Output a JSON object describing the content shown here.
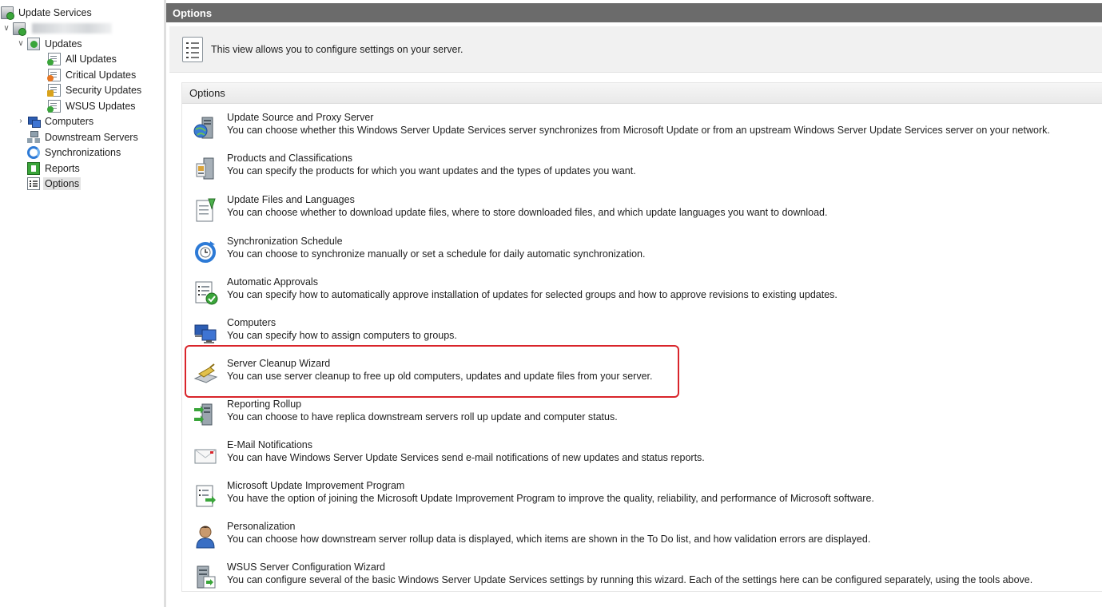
{
  "tree": {
    "root": "Update Services",
    "server": "",
    "updates": "Updates",
    "all_updates": "All Updates",
    "critical_updates": "Critical Updates",
    "security_updates": "Security Updates",
    "wsus_updates": "WSUS Updates",
    "computers": "Computers",
    "downstream_servers": "Downstream Servers",
    "synchronizations": "Synchronizations",
    "reports": "Reports",
    "options": "Options"
  },
  "main": {
    "title": "Options",
    "intro": "This view allows you to configure settings on your server.",
    "section_header": "Options",
    "items": [
      {
        "title": "Update Source and Proxy Server",
        "desc": "You can choose whether this Windows Server Update Services server synchronizes from Microsoft Update or from an upstream Windows Server Update Services server on your network.",
        "icon": "server-globe-icon"
      },
      {
        "title": "Products and Classifications",
        "desc": "You can specify the products for which you want updates and the types of updates you want.",
        "icon": "products-icon"
      },
      {
        "title": "Update Files and Languages",
        "desc": "You can choose whether to download update files, where to store downloaded files, and which update languages you want to download.",
        "icon": "update-files-icon"
      },
      {
        "title": "Synchronization Schedule",
        "desc": "You can choose to synchronize manually or set a schedule for daily automatic synchronization.",
        "icon": "sync-schedule-icon"
      },
      {
        "title": "Automatic Approvals",
        "desc": "You can specify how to automatically approve installation of updates for selected groups and how to approve revisions to existing updates.",
        "icon": "approvals-icon"
      },
      {
        "title": "Computers",
        "desc": "You can specify how to assign computers to groups.",
        "icon": "computers-icon"
      },
      {
        "title": "Server Cleanup Wizard",
        "desc": "You can use server cleanup to free up old computers, updates and update files from your server.",
        "icon": "cleanup-icon"
      },
      {
        "title": "Reporting Rollup",
        "desc": "You can choose to have replica downstream servers roll up update and computer status.",
        "icon": "rollup-icon"
      },
      {
        "title": "E-Mail Notifications",
        "desc": "You can have Windows Server Update Services send e-mail notifications of new updates and status reports.",
        "icon": "email-icon"
      },
      {
        "title": "Microsoft Update Improvement Program",
        "desc": "You have the option of joining the Microsoft Update Improvement Program to improve the quality, reliability, and performance of Microsoft software.",
        "icon": "improvement-program-icon"
      },
      {
        "title": "Personalization",
        "desc": "You can choose how downstream server rollup data is displayed, which items are shown in the To Do list, and how validation errors are displayed.",
        "icon": "personalization-icon"
      },
      {
        "title": "WSUS Server Configuration Wizard",
        "desc": "You can configure several of the basic Windows Server Update Services settings by running this wizard. Each of the settings here can be configured separately, using the tools above.",
        "icon": "config-wizard-icon"
      }
    ]
  },
  "colors": {
    "title_bar": "#6b6b6b",
    "highlight": "#d9252b",
    "green": "#3aa53a",
    "blue": "#2d5db3"
  }
}
